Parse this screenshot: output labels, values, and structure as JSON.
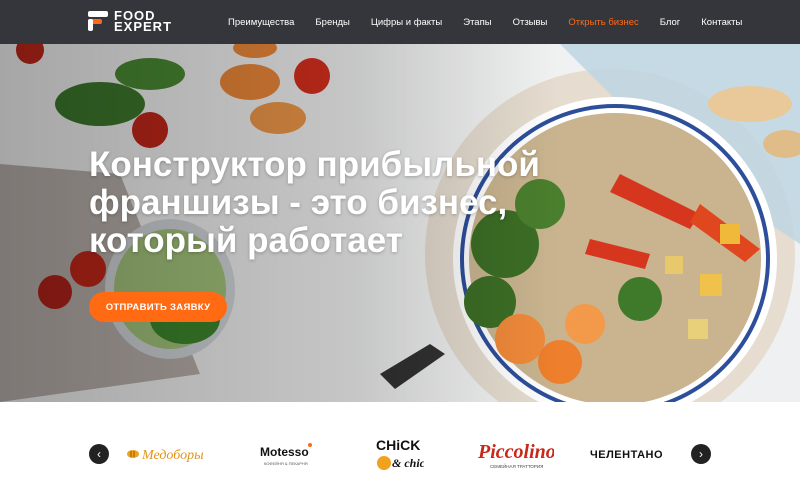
{
  "header": {
    "logo": {
      "line1": "FOOD",
      "line2": "EXPERT"
    },
    "nav": [
      {
        "label": "Преимущества",
        "active": false
      },
      {
        "label": "Бренды",
        "active": false
      },
      {
        "label": "Цифры и факты",
        "active": false
      },
      {
        "label": "Этапы",
        "active": false
      },
      {
        "label": "Отзывы",
        "active": false
      },
      {
        "label": "Открыть бизнес",
        "active": true
      },
      {
        "label": "Блог",
        "active": false
      },
      {
        "label": "Контакты",
        "active": false
      }
    ]
  },
  "hero": {
    "title_lines": [
      "Конструктор прибыльной",
      "франшизы - это бизнес,",
      "который работает"
    ],
    "cta_label": "ОТПРАВИТЬ ЗАЯВКУ"
  },
  "brands": {
    "prev_icon": "chevron-left-icon",
    "next_icon": "chevron-right-icon",
    "items": [
      {
        "name": "Медоборы"
      },
      {
        "name": "Motesso",
        "tagline": "КОФЕЙНЯ & ПЕКАРНЯ"
      },
      {
        "name_top": "CHiCK",
        "name_bottom": "& chic"
      },
      {
        "name": "Piccolino",
        "tagline": "СЕМЕЙНАЯ ТРАТТОРИЯ"
      },
      {
        "name": "ЧЕЛЕНТАНО"
      }
    ]
  },
  "colors": {
    "accent": "#ff6a13",
    "header_bg": "#34363b"
  }
}
